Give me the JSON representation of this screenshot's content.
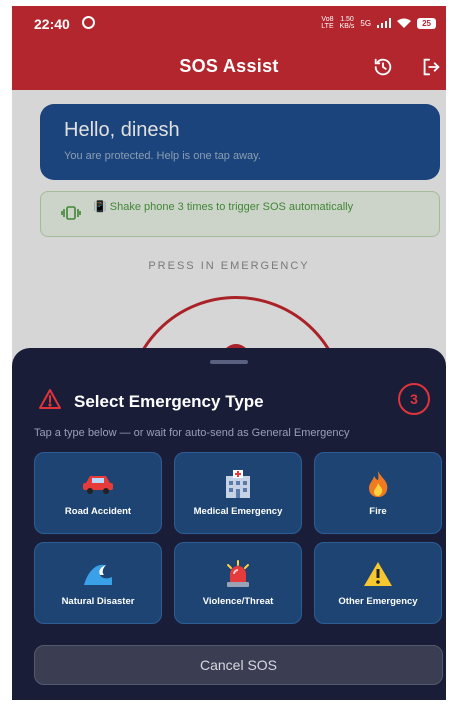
{
  "status_bar": {
    "time": "22:40",
    "network_top": "Vo8",
    "network_bottom": "LTE",
    "speed_top": "1.50",
    "speed_bottom": "KB/s",
    "signal_label": "5G",
    "battery": "25"
  },
  "app_bar": {
    "title": "SOS Assist"
  },
  "greeting": {
    "title": "Hello, dinesh",
    "subtitle": "You are protected. Help is one tap away."
  },
  "shake_banner": {
    "icon_text": "📳",
    "text": "Shake phone 3 times to trigger SOS automatically"
  },
  "press_label": "PRESS IN EMERGENCY",
  "sheet": {
    "title": "Select Emergency Type",
    "countdown": "3",
    "hint": "Tap a type below — or wait for auto-send as General Emergency",
    "types": [
      {
        "label": "Road Accident",
        "icon": "car-icon"
      },
      {
        "label": "Medical Emergency",
        "icon": "hospital-icon"
      },
      {
        "label": "Fire",
        "icon": "fire-icon"
      },
      {
        "label": "Natural Disaster",
        "icon": "wave-icon"
      },
      {
        "label": "Violence/Threat",
        "icon": "siren-icon"
      },
      {
        "label": "Other Emergency",
        "icon": "warning-icon"
      }
    ],
    "cancel_label": "Cancel SOS"
  },
  "colors": {
    "primary_red": "#b3262e",
    "card_blue": "#1e4474",
    "sheet_bg": "#1a1d38",
    "alert_red": "#e0333a"
  }
}
